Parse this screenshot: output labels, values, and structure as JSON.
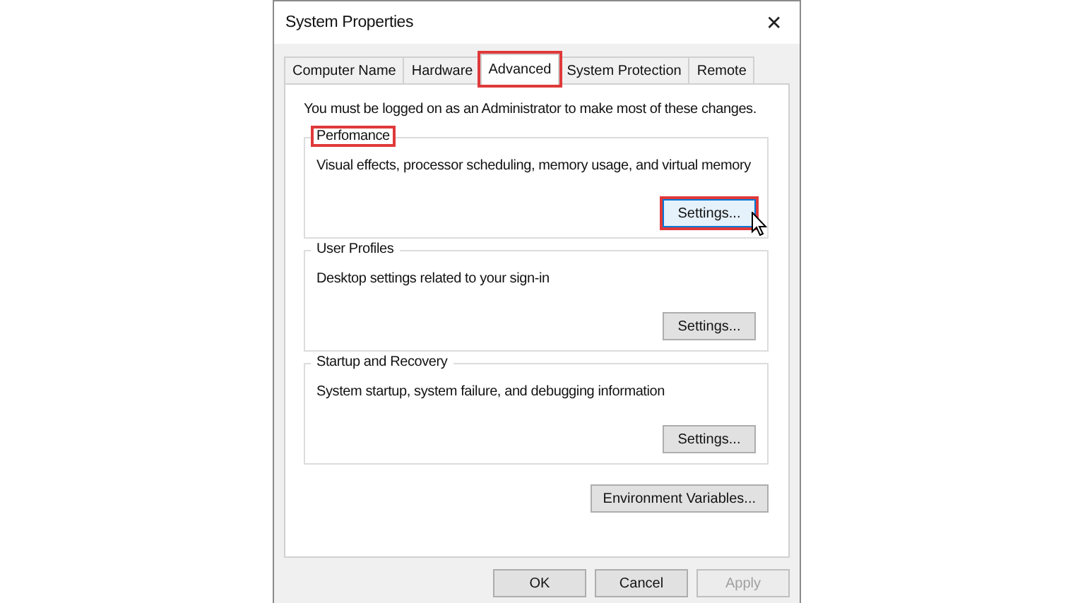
{
  "window": {
    "title": "System Properties",
    "close": "✕"
  },
  "tabs": [
    {
      "label": "Computer Name",
      "selected": false,
      "highlighted": false
    },
    {
      "label": "Hardware",
      "selected": false,
      "highlighted": false
    },
    {
      "label": "Advanced",
      "selected": true,
      "highlighted": true
    },
    {
      "label": "System Protection",
      "selected": false,
      "highlighted": false
    },
    {
      "label": "Remote",
      "selected": false,
      "highlighted": false
    }
  ],
  "notice": "You must be logged on as an Administrator to make most of these changes.",
  "groups": [
    {
      "title": "Perfomance",
      "title_highlighted": true,
      "description": "Visual effects, processor scheduling, memory usage, and virtual memory",
      "button": {
        "label": "Settings...",
        "highlighted": true,
        "hovered": true
      }
    },
    {
      "title": "User Profiles",
      "title_highlighted": false,
      "description": "Desktop settings related to your sign-in",
      "button": {
        "label": "Settings...",
        "highlighted": false,
        "hovered": false
      }
    },
    {
      "title": "Startup and Recovery",
      "title_highlighted": false,
      "description": "System startup, system failure, and debugging information",
      "button": {
        "label": "Settings...",
        "highlighted": false,
        "hovered": false
      }
    }
  ],
  "environment_button": {
    "label": "Environment Variables..."
  },
  "buttons": [
    {
      "label": "OK",
      "disabled": false
    },
    {
      "label": "Cancel",
      "disabled": false
    },
    {
      "label": "Apply",
      "disabled": true
    }
  ]
}
